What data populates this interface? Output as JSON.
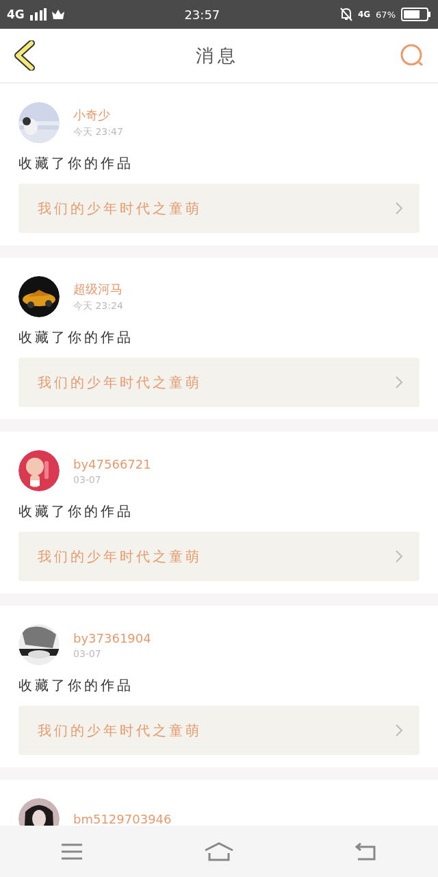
{
  "status_bar": {
    "network": "4G",
    "time": "23:57",
    "network_right": "4G",
    "battery": "67%"
  },
  "header": {
    "title": "消息"
  },
  "messages": [
    {
      "name": "小奇少",
      "time": "今天  23:47",
      "action": "收藏了你的作品",
      "work": "我们的少年时代之童萌"
    },
    {
      "name": "超级河马",
      "time": "今天  23:24",
      "action": "收藏了你的作品",
      "work": "我们的少年时代之童萌"
    },
    {
      "name": "by47566721",
      "time": "03-07",
      "action": "收藏了你的作品",
      "work": "我们的少年时代之童萌"
    },
    {
      "name": "by37361904",
      "time": "03-07",
      "action": "收藏了你的作品",
      "work": "我们的少年时代之童萌"
    },
    {
      "name": "bm5129703946"
    }
  ]
}
